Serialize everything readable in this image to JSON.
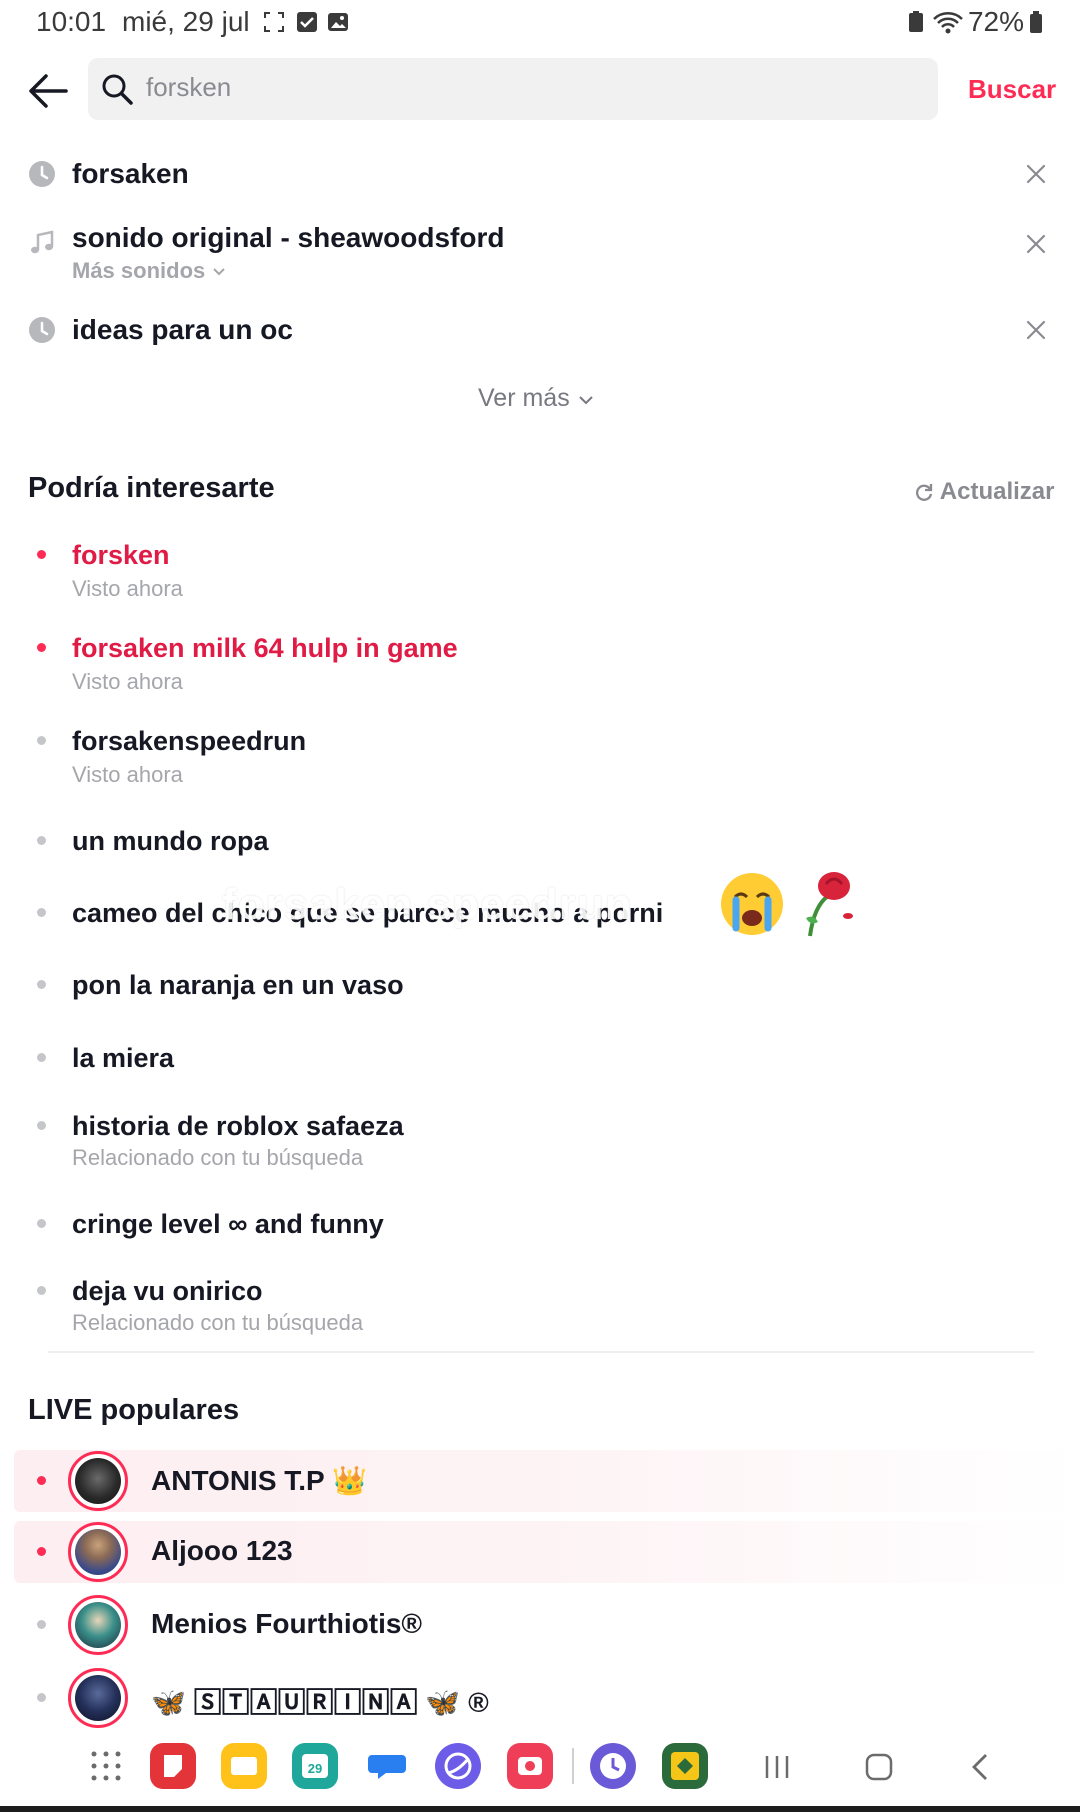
{
  "status_bar": {
    "time": "10:01",
    "date": "mié, 29 jul",
    "battery": "72%"
  },
  "search": {
    "query": "forsken",
    "submit_label": "Buscar"
  },
  "history": [
    {
      "icon": "clock-icon",
      "label": "forsaken"
    },
    {
      "icon": "music-note-icon",
      "label": "sonido original - sheawoodsford",
      "sub": "Más sonidos"
    },
    {
      "icon": "clock-icon",
      "label": "ideas para un oc"
    }
  ],
  "see_more": "Ver más",
  "suggestions_section": {
    "title": "Podría interesarte",
    "refresh_label": "Actualizar"
  },
  "suggestions": [
    {
      "label": "forsken",
      "sub": "Visto ahora",
      "highlight": true
    },
    {
      "label": "forsaken milk 64 hulp in game",
      "sub": "Visto ahora",
      "highlight": true
    },
    {
      "label": "forsakenspeedrun",
      "sub": "Visto ahora"
    },
    {
      "label": "un mundo ropa"
    },
    {
      "label": "cameo del chico que se parece mucho a porni"
    },
    {
      "label": "pon la naranja en un vaso"
    },
    {
      "label": "la miera"
    },
    {
      "label": "historia de roblox safaeza",
      "sub": "Relacionado con tu búsqueda"
    },
    {
      "label": "cringe level ∞ and funny"
    },
    {
      "label": "deja vu onirico",
      "sub": "Relacionado con tu búsqueda"
    }
  ],
  "overlay_text": "forsaken speedrun",
  "live_section": {
    "title": "LIVE populares"
  },
  "live": [
    {
      "name": "ANTONIS T.P 👑",
      "highlight": true
    },
    {
      "name": "Aljooo 123",
      "highlight": true
    },
    {
      "name": "Menios Fourthiotis®"
    },
    {
      "name": "🦋 🅂🅃🄰🅄🅁🄸🄽🄰 🦋 ®"
    }
  ],
  "colors": {
    "accent": "#fe2c55",
    "text": "#161823",
    "muted": "#a5a6ab"
  }
}
